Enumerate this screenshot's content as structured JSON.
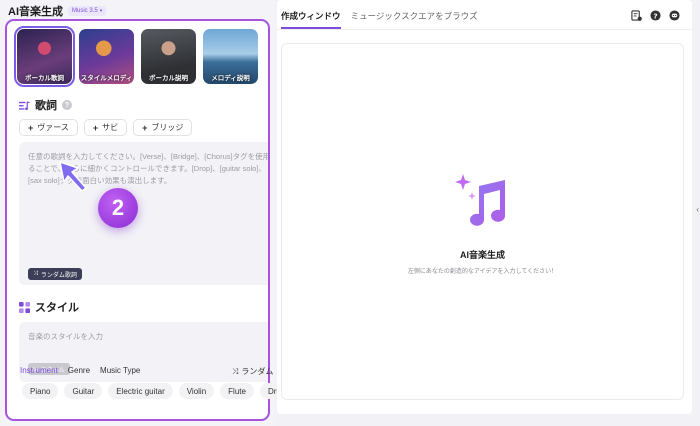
{
  "app": {
    "title": "AI音楽生成",
    "version": "Music 3.5"
  },
  "presets": [
    {
      "label": "ボーカル歌詞",
      "selected": true
    },
    {
      "label": "スタイルメロディ",
      "selected": false
    },
    {
      "label": "ボーカル説明",
      "selected": false
    },
    {
      "label": "メロディ説明",
      "selected": false
    }
  ],
  "lyrics": {
    "title": "歌詞",
    "chips": [
      "ヴァース",
      "サビ",
      "ブリッジ"
    ],
    "placeholder": "任意の歌詞を入力してください。[Verse]、[Bridge]、[Chorus]タグを使用することで、さらに細かくコントロールできます。[Drop]、[guitar solo]、[sax solo]タグで面白い効果も演出します。",
    "random_label": "ランダム歌詞"
  },
  "style": {
    "title": "スタイル",
    "placeholder": "音楽のスタイルを入力",
    "button_label": "スタイル",
    "tabs": [
      "Instrument",
      "Genre",
      "Music Type"
    ],
    "active_tab": "Instrument",
    "random_label": "ランダム",
    "tags": [
      "Piano",
      "Guitar",
      "Electric guitar",
      "Violin",
      "Flute",
      "Drum"
    ]
  },
  "step_badge": "2",
  "workspace": {
    "tabs": [
      "作成ウィンドウ",
      "ミュージックスクエアをブラウズ"
    ],
    "active_tab": "作成ウィンドウ",
    "empty_title": "AI音楽生成",
    "empty_subtitle": "左側にあなたの創造的なアイデアを入力してください！"
  },
  "colors": {
    "accent": "#7c4ddc",
    "highlight_border": "#a653e0"
  },
  "icons": [
    "history-icon",
    "help-icon",
    "discord-icon",
    "music-note-icon",
    "sparkle-icon"
  ]
}
